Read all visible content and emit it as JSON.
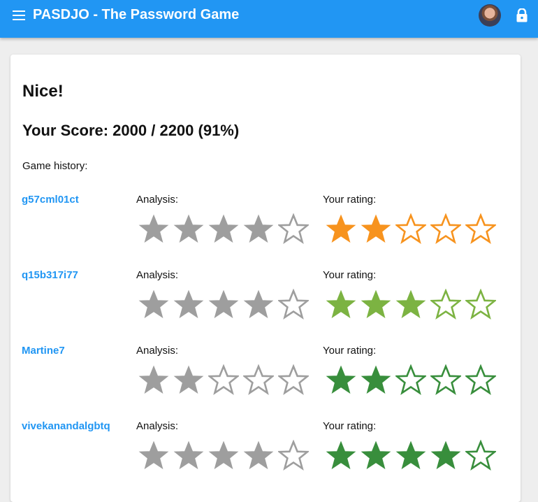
{
  "appbar": {
    "title": "PASDJO - The Password Game",
    "menu_icon": "menu-icon",
    "avatar_icon": "user-avatar",
    "lock_icon": "lock-icon"
  },
  "colors": {
    "appbar": "#2196f3",
    "link": "#2196f3",
    "star_grey": "#9e9e9e",
    "star_orange": "#f7931e",
    "star_light_green": "#7cb342",
    "star_dark_green": "#388e3c"
  },
  "result": {
    "heading": "Nice!",
    "score": "Your Score: 2000 / 2200 (91%)"
  },
  "history": {
    "label": "Game history:",
    "analysis_label": "Analysis:",
    "rating_label": "Your rating:",
    "games": [
      {
        "id": "g57cml01ct",
        "analysis": 4,
        "rating": 2,
        "rating_color": "#f7931e"
      },
      {
        "id": "q15b317i77",
        "analysis": 4,
        "rating": 3,
        "rating_color": "#7cb342"
      },
      {
        "id": "Martine7",
        "analysis": 2,
        "rating": 2,
        "rating_color": "#388e3c"
      },
      {
        "id": "vivekanandalgbtq",
        "analysis": 4,
        "rating": 4,
        "rating_color": "#388e3c"
      }
    ],
    "max_stars": 5
  }
}
